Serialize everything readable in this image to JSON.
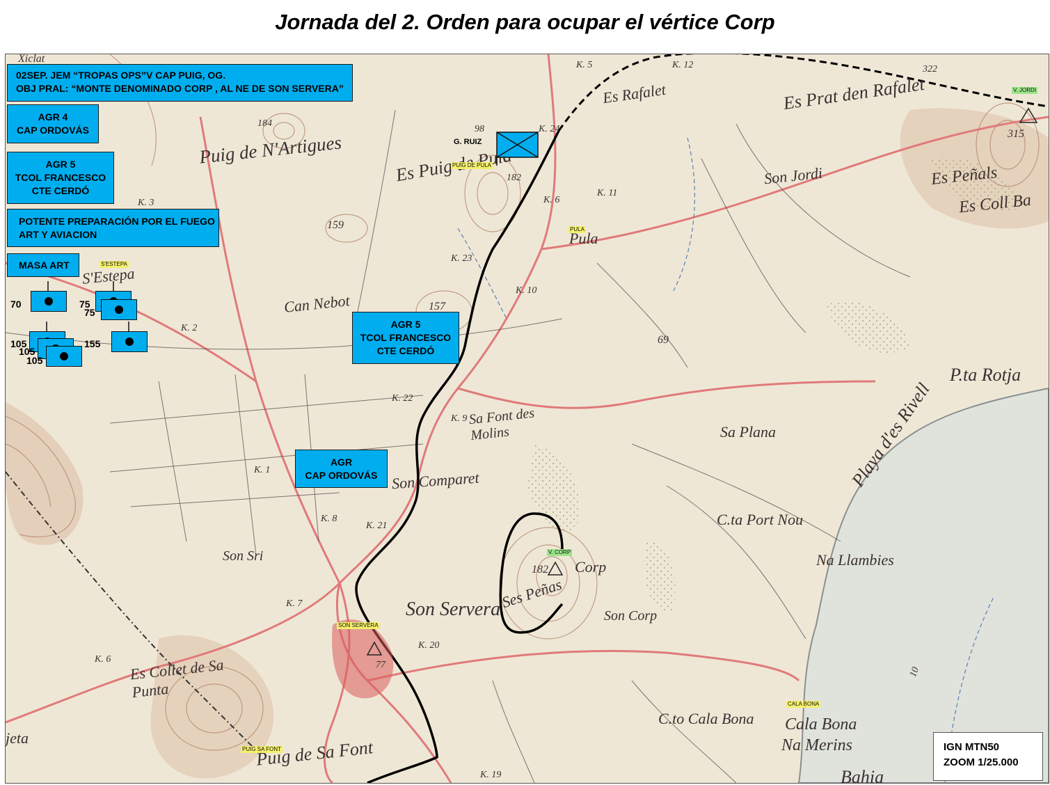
{
  "title": "Jornada del 2. Orden para ocupar el vértice Corp",
  "info_boxes": {
    "order": [
      "02SEP. JEM  “TROPAS OPS”V CAP PUIG, OG.",
      "OBJ PRAL: “MONTE DENOMINADO CORP , AL NE DE SON SERVERA”"
    ],
    "agr4": [
      "AGR 4",
      "CAP ORDOVÁS"
    ],
    "agr5": [
      "AGR 5",
      "TCOL FRANCESCO",
      "CTE CERDÓ"
    ],
    "fire": [
      "POTENTE PREPARACIÓN POR EL FUEGO",
      "ART Y AVIACION"
    ],
    "masa_art": "MASA ART",
    "agr5_map": [
      "AGR 5",
      "TCOL FRANCESCO",
      "CTE CERDÓ"
    ],
    "agr_map": [
      "AGR",
      "CAP ORDOVÁS"
    ]
  },
  "artillery_labels": [
    "70",
    "75",
    "75",
    "105",
    "105",
    "105",
    "155"
  ],
  "unit_label": "G. RUIZ",
  "yellow_labels": [
    "PUIG DE PULA",
    "PULA",
    "S'ESTEPA",
    "SON SERVERA",
    "CALA BONA",
    "PUIG SA FONT"
  ],
  "green_labels": [
    "V. JORDI",
    "V. CORP"
  ],
  "map_places": [
    "Es Rafalet",
    "Es Prat den Rafalet",
    "Puig de N'Artigues",
    "Es Puig de Pula",
    "Son Jordi",
    "Es Peñals",
    "Es Coll Ba",
    "Pula",
    "S'Estepa",
    "Can Nebot",
    "Playa d'es Rivell",
    "P.ta Rotja",
    "Sa Font des Molins",
    "Sa Plana",
    "Son Comparet",
    "C.ta Port Nou",
    "Na Llambies",
    "Son Sri",
    "Corp",
    "Ses Peñas",
    "Son Servera",
    "Son Corp",
    "Es Collet de Sa Punta",
    "C.to Cala Bona",
    "Cala Bona",
    "Na Merins",
    "Puig de Sa Font",
    "Bahia",
    "jeta",
    "Xiclat"
  ],
  "map_numbers": [
    "K. 5",
    "K. 12",
    "322",
    "315",
    "184",
    "182",
    "K. 24",
    "K. 3",
    "K. 11",
    "K. 6",
    "159",
    "K. 23",
    "K. 10",
    "157",
    "K. 2",
    "69",
    "K. 22",
    "K. 9",
    "K. 1",
    "K. 8",
    "K. 21",
    "K. 7",
    "182",
    "K. 20",
    "K. 6",
    "77",
    "K. 19",
    "98",
    "10"
  ],
  "legend": [
    "IGN MTN50",
    "ZOOM 1/25.000"
  ],
  "colors": {
    "box_blue": "#00aeef",
    "yellow_label": "#f5f06a",
    "green_label": "#9be58a",
    "map_bg": "#efe7d6",
    "road": "#e07a7a",
    "contour": "#b58a72"
  }
}
